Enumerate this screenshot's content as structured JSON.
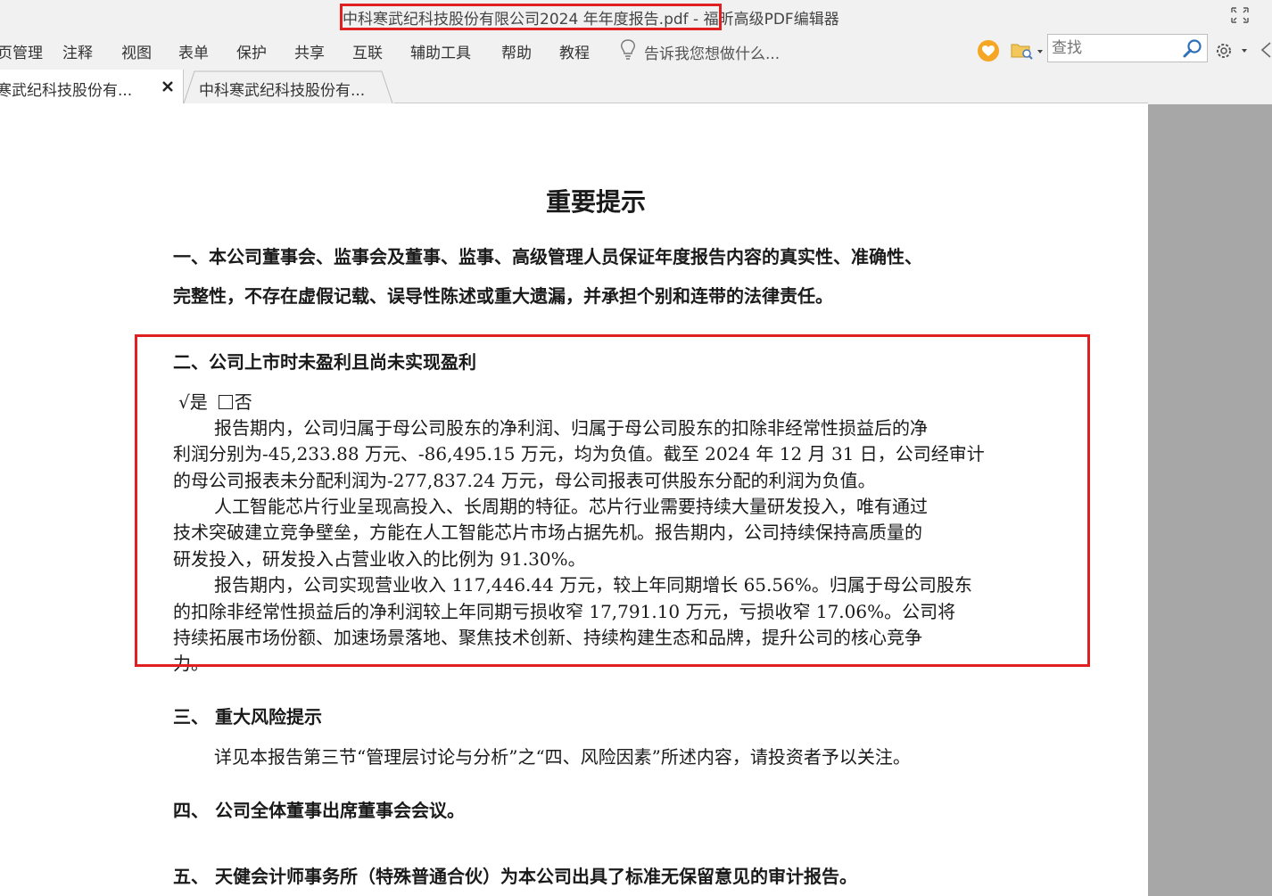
{
  "titlebar": {
    "file_name": "中科寒武纪科技股份有限公司2024 年年度报告.pdf -",
    "app_name": "福昕高级PDF编辑器"
  },
  "menu": {
    "items": [
      "页管理",
      "注释",
      "视图",
      "表单",
      "保护",
      "共享",
      "互联",
      "辅助工具",
      "帮助",
      "教程"
    ],
    "tellme_placeholder": "告诉我您想做什么..."
  },
  "search": {
    "placeholder": "查找"
  },
  "tabs": [
    {
      "label": "寒武纪科技股份有...",
      "active": true
    },
    {
      "label": "中科寒武纪科技股份有...",
      "active": false
    }
  ],
  "document": {
    "title": "重要提示",
    "section1_line1": "一、本公司董事会、监事会及董事、监事、高级管理人员保证年度报告内容的真实性、准确性、",
    "section1_line2": "完整性，不存在虚假记载、误导性陈述或重大遗漏，并承担个别和连带的法律责任。",
    "section2_heading": "二、公司上市时未盈利且尚未实现盈利",
    "section2_yes": "√是",
    "section2_no": "否",
    "para1": [
      "报告期内，公司归属于母公司股东的净利润、归属于母公司股东的扣除非经常性损益后的净",
      "利润分别为-45,233.88 万元、-86,495.15 万元，均为负值。截至 2024 年 12 月 31 日，公司经审计",
      "的母公司报表未分配利润为-277,837.24 万元，母公司报表可供股东分配的利润为负值。"
    ],
    "para2": [
      "人工智能芯片行业呈现高投入、长周期的特征。芯片行业需要持续大量研发投入，唯有通过",
      "技术突破建立竞争壁垒，方能在人工智能芯片市场占据先机。报告期内，公司持续保持高质量的",
      "研发投入，研发投入占营业收入的比例为 91.30%。"
    ],
    "para3": [
      "报告期内，公司实现营业收入 117,446.44 万元，较上年同期增长 65.56%。归属于母公司股东",
      "的扣除非经常性损益后的净利润较上年同期亏损收窄 17,791.10 万元，亏损收窄 17.06%。公司将",
      "持续拓展市场份额、加速场景落地、聚焦技术创新、持续构建生态和品牌，提升公司的核心竞争",
      "力。"
    ],
    "section3_heading": "三、 重大风险提示",
    "section3_text": "详见本报告第三节“管理层讨论与分析”之“四、风险因素”所述内容，请投资者予以关注。",
    "section4_heading": "四、 公司全体董事出席董事会会议。",
    "section5_heading": "五、  天健会计师事务所（特殊普通合伙）为本公司出具了标准无保留意见的审计报告。"
  },
  "colors": {
    "highlight": "#e02020",
    "chrome": "#f1f1f1",
    "gutter": "#a7a7a7"
  }
}
